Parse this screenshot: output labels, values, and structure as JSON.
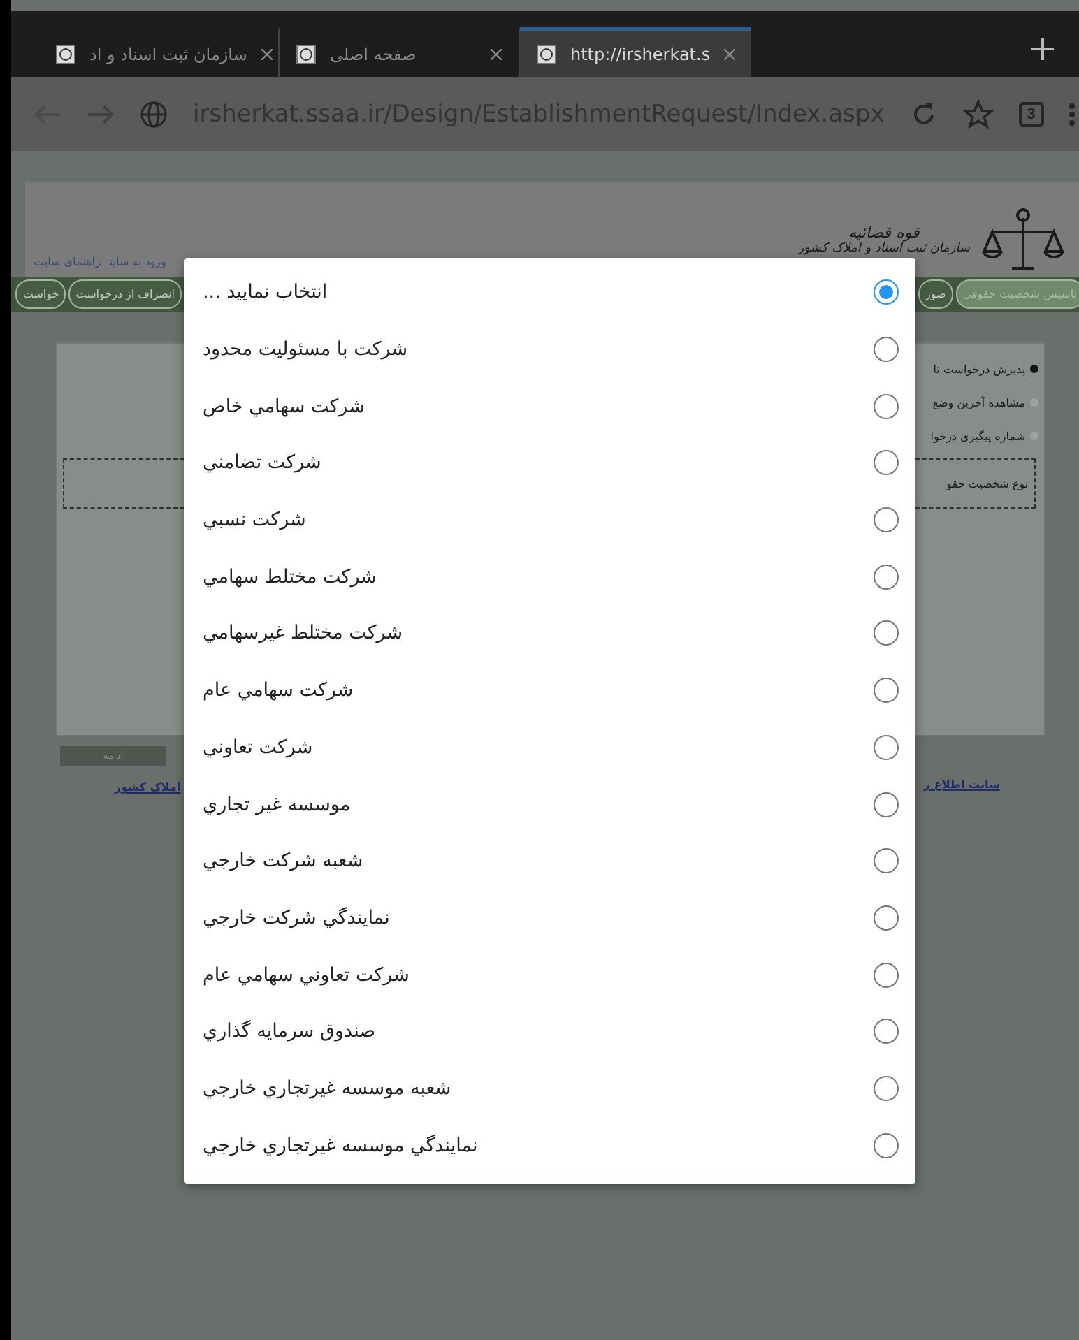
{
  "browser": {
    "tabs": {
      "left_tab": {
        "title": "سازمان ثبت اسناد و اد",
        "selected": false
      },
      "middle_tab": {
        "title": "صفحه اصلی",
        "selected": false
      },
      "right_tab": {
        "title": "http://irsherkat.s",
        "selected": true
      }
    },
    "tab_count": "3",
    "url": "irsherkat.ssaa.ir/Design/EstablishmentRequest/Index.aspx"
  },
  "page": {
    "header": {
      "logo_title": "قوه قضائیه",
      "logo_subtitle": "سازمان ثبت اسناد و املاک کشور",
      "links": [
        "ورود به سایت",
        "راهنمای سایت"
      ]
    },
    "nav_left": [
      "انصراف از درخواست",
      "خواست"
    ],
    "nav_right": [
      {
        "label": "تاسیس شخصیت حقوقی",
        "selected": true
      },
      {
        "label": "صور",
        "selected": false
      }
    ],
    "options": [
      {
        "label": "پذیرش درخواست تا",
        "selected": true
      },
      {
        "label": "مشاهده آخرین وضع",
        "selected": false
      },
      {
        "label": "شماره پیگیری درخوا",
        "selected": false
      }
    ],
    "field_label": "نوع شخصیت حقو",
    "button": "ادامه",
    "footer_left_link": "املاک کشور",
    "footer_right_link": "سایت اطلاع ر"
  },
  "dialog": {
    "options": [
      {
        "label": "انتخاب نمایید ...",
        "selected": true
      },
      {
        "label": "شرکت با مسئولیت محدود",
        "selected": false
      },
      {
        "label": "شرکت سهامي خاص",
        "selected": false
      },
      {
        "label": "شرکت تضامني",
        "selected": false
      },
      {
        "label": "شرکت نسبي",
        "selected": false
      },
      {
        "label": "شرکت مختلط سهامي",
        "selected": false
      },
      {
        "label": "شرکت مختلط غيرسهامي",
        "selected": false
      },
      {
        "label": "شرکت سهامي عام",
        "selected": false
      },
      {
        "label": "شرکت تعاوني",
        "selected": false
      },
      {
        "label": "موسسه غير تجاري",
        "selected": false
      },
      {
        "label": "شعبه شرکت خارجي",
        "selected": false
      },
      {
        "label": "نمايندگي شرکت خارجي",
        "selected": false
      },
      {
        "label": "شرکت تعاوني سهامي عام",
        "selected": false
      },
      {
        "label": "صندوق سرمايه گذاري",
        "selected": false
      },
      {
        "label": "شعبه موسسه غيرتجاري خارجي",
        "selected": false
      },
      {
        "label": "نمايندگي موسسه غيرتجاري خارجي",
        "selected": false
      }
    ]
  }
}
